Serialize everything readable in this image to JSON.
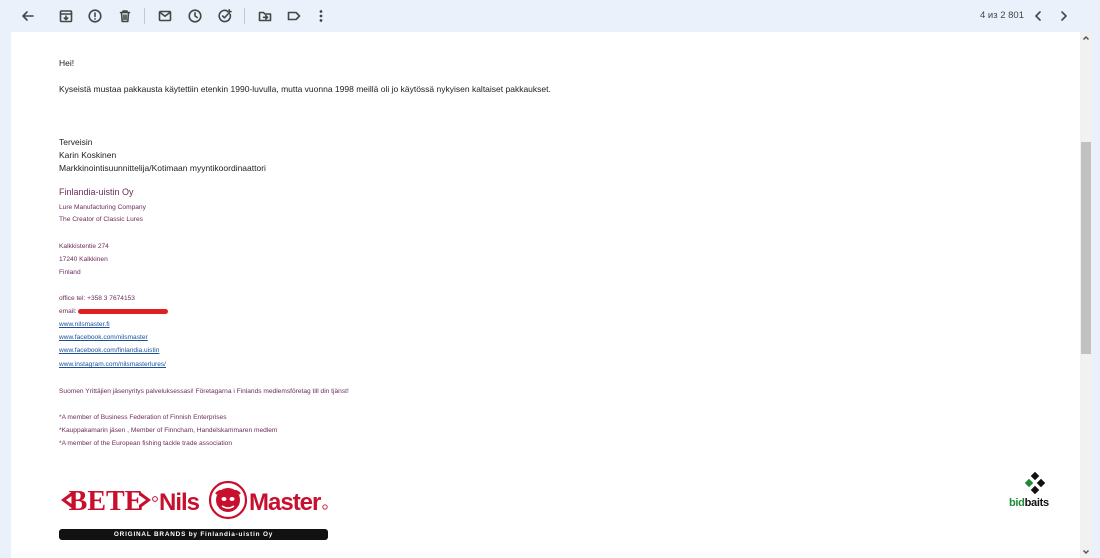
{
  "toolbar": {
    "counter": "4 из 2 801",
    "icons": [
      "back-arrow-icon",
      "archive-icon",
      "report-spam-icon",
      "delete-icon",
      "mark-unread-icon",
      "snooze-icon",
      "add-to-tasks-icon",
      "move-to-icon",
      "label-icon",
      "more-vert-icon",
      "chevron-left-icon",
      "chevron-right-icon"
    ]
  },
  "email": {
    "greeting": "Hei!",
    "paragraph": "Kyseistä mustaa pakkausta käytettiin etenkin 1990-luvulla, mutta vuonna 1998 meillä oli jo käytössä nykyisen kaltaiset pakkaukset.",
    "signoff": "Terveisin",
    "name": "Karin Koskinen",
    "role": "Markkinointisuunnittelija/Kotimaan myyntikoordinaattori",
    "company": "Finlandia-uistin Oy",
    "tagline1": "Lure Manufacturing Company",
    "tagline2": "The Creator of Classic Lures",
    "address1": "Kalkkistentie 274",
    "address2": "17240 Kalkkinen",
    "address3": "Finland",
    "phone": "office tel: +358 3 7674153",
    "email_label": "email:",
    "links": [
      "www.nilsmaster.fi",
      "www.facebook.com/nilsmaster",
      "www.facebook.com/finlandia.uistin",
      "www.instagram.com/nilsmasterlures/"
    ],
    "membership_line": "Suomen Yrittäjien jäsenyritys palveluksessasi! Företagarna i Finlands medlemsföretag till din tjänst!",
    "member1": "*A member of Business Federation of Finnish Enterprises",
    "member2": "*Kauppakamarin jäsen , Member of Finncham, Handelskammaren medlem",
    "member3": "*A member of the European fishing tackle trade association",
    "brand_bar": "ORIGINAL BRANDS by Finlandia-uistin Oy",
    "logo_bete": "BETE",
    "logo_nils": "Nils",
    "logo_master": "Master",
    "watermark_bid": "bid",
    "watermark_baits": "baits"
  },
  "colors": {
    "accent_purple": "#6b2c5a",
    "link": "#1a4f9c",
    "logo_red": "#c8102e",
    "redaction": "#e02020"
  }
}
